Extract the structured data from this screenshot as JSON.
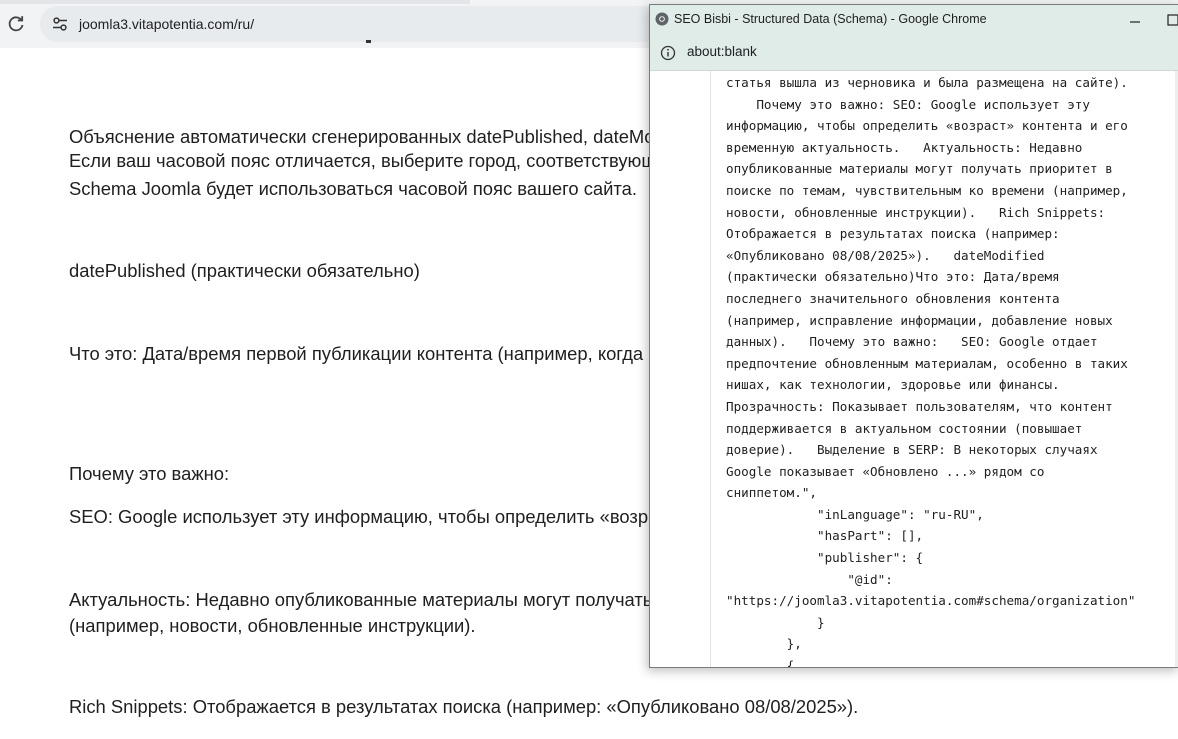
{
  "browser": {
    "url": "joomla3.vitapotentia.com/ru/"
  },
  "page": {
    "lines": [
      "Объяснение автоматически сгенерированных datePublished, dateModified",
      "Если ваш часовой пояс отличается, выберите город, соответствующий",
      "Schema Joomla будет использоваться часовой пояс вашего сайта.",
      "datePublished (практически обязательно)",
      "Что это: Дата/время первой публикации контента (например, когда",
      "Почему это важно:",
      "SEO: Google использует эту информацию, чтобы определить «возраст»",
      "Актуальность: Недавно опубликованные материалы могут получать",
      "(например, новости, обновленные инструкции).",
      "Rich Snippets: Отображается в результатах поиска (например: «Опубликовано 08/08/2025»)."
    ]
  },
  "popup": {
    "title": "SEO Bisbi - Structured Data (Schema) - Google Chrome",
    "address": "about:blank",
    "code_lines": [
      "статья вышла из черновика и была размещена на сайте).",
      "    Почему это важно: SEO: Google использует эту",
      "информацию, чтобы определить «возраст» контента и его",
      "временную актуальность.   Актуальность: Недавно",
      "опубликованные материалы могут получать приоритет в",
      "поиске по темам, чувствительным ко времени (например,",
      "новости, обновленные инструкции).   Rich Snippets:",
      "Отображается в результатах поиска (например:",
      "«Опубликовано 08/08/2025»).   dateModified",
      "(практически обязательно)Что это: Дата/время",
      "последнего значительного обновления контента",
      "(например, исправление информации, добавление новых",
      "данных).   Почему это важно:   SEO: Google отдает",
      "предпочтение обновленным материалам, особенно в таких",
      "нишах, как технологии, здоровье или финансы.",
      "Прозрачность: Показывает пользователям, что контент",
      "поддерживается в актуальном состоянии (повышает",
      "доверие).   Выделение в SERP: В некоторых случаях",
      "Google показывает «Обновлено ...» рядом со",
      "сниппетом.\",",
      "            \"inLanguage\": \"ru-RU\",",
      "            \"hasPart\": [],",
      "            \"publisher\": {",
      "                \"@id\":",
      "\"https://joomla3.vitapotentia.com#schema/organization\"",
      "            }",
      "        },",
      "        {"
    ]
  },
  "icons": {
    "reload": "reload-icon",
    "site_settings": "tune-icon",
    "chrome": "chrome-icon",
    "info": "info-icon",
    "minimize": "minimize-icon",
    "maximize": "maximize-icon"
  }
}
